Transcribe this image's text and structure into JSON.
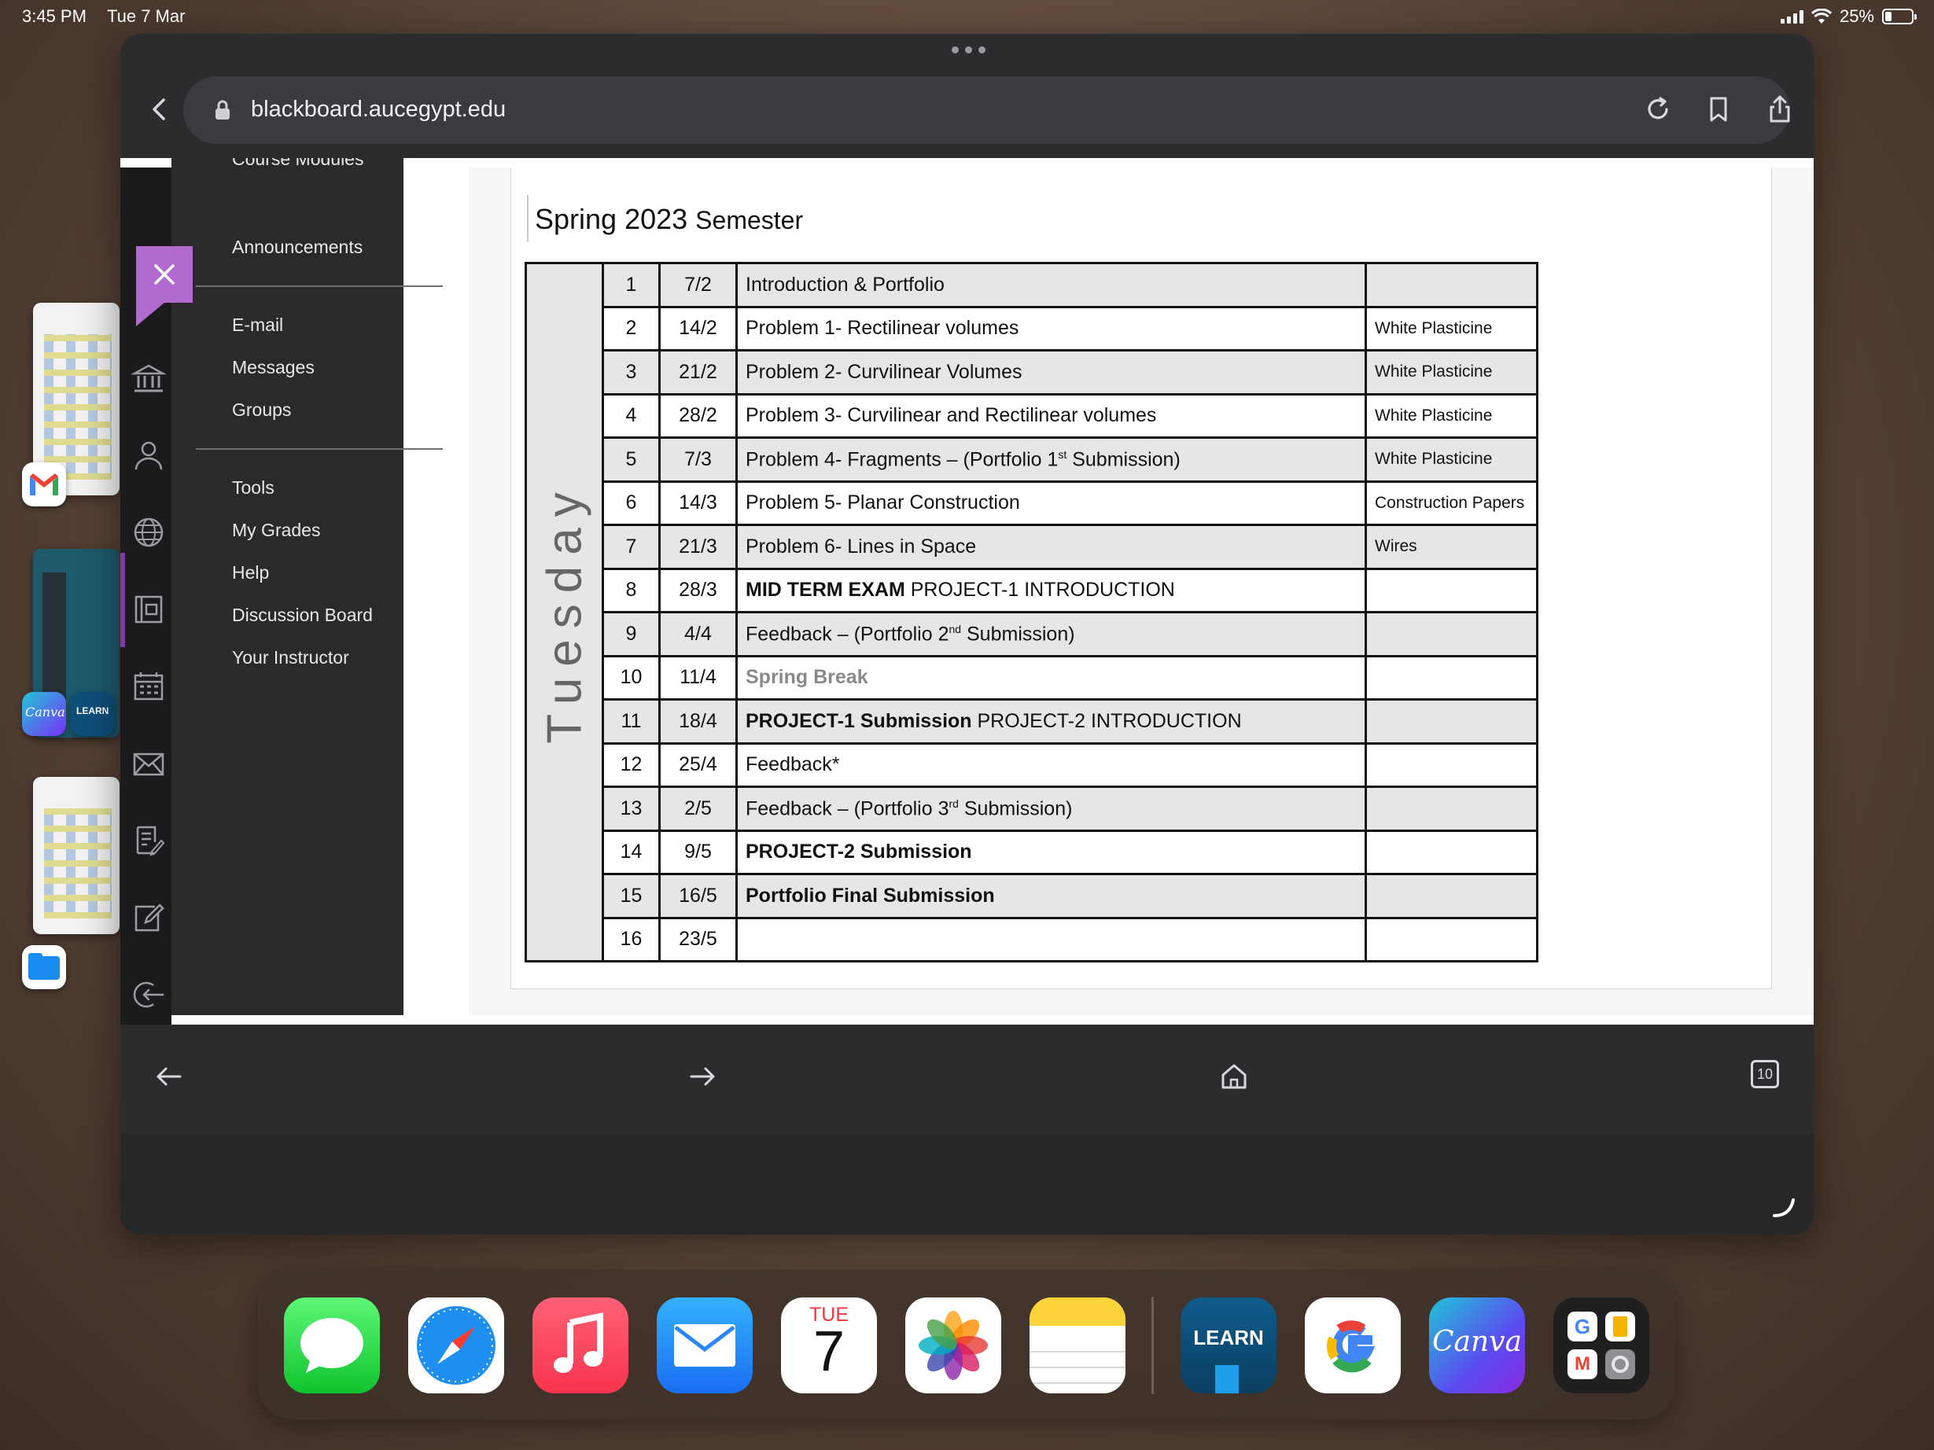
{
  "status_bar": {
    "time": "3:45 PM",
    "date": "Tue 7 Mar",
    "battery": "25%",
    "battery_level": 0.25
  },
  "browser": {
    "url": "blackboard.aucegypt.edu"
  },
  "course_menu": {
    "items": [
      {
        "label": "Course Modules"
      },
      {
        "label": "Announcements"
      },
      {
        "label": "E-mail"
      },
      {
        "label": "Messages"
      },
      {
        "label": "Groups"
      },
      {
        "label": "Tools"
      },
      {
        "label": "My Grades"
      },
      {
        "label": "Help"
      },
      {
        "label": "Discussion Board"
      },
      {
        "label": "Your Instructor"
      }
    ]
  },
  "document": {
    "title_main": "Spring 2023",
    "title_small": "Semester",
    "day": "Tuesday",
    "rows": [
      {
        "num": "1",
        "date": "7/2",
        "parts": [
          {
            "t": "Introduction & Portfolio"
          }
        ],
        "material": ""
      },
      {
        "num": "2",
        "date": "14/2",
        "parts": [
          {
            "t": "Problem 1- Rectilinear volumes"
          }
        ],
        "material": "White Plasticine"
      },
      {
        "num": "3",
        "date": "21/2",
        "parts": [
          {
            "t": "Problem 2- Curvilinear Volumes"
          }
        ],
        "material": "White Plasticine"
      },
      {
        "num": "4",
        "date": "28/2",
        "parts": [
          {
            "t": "Problem 3- Curvilinear and Rectilinear volumes"
          }
        ],
        "material": "White Plasticine"
      },
      {
        "num": "5",
        "date": "7/3",
        "parts": [
          {
            "t": "Problem 4- Fragments – (Portfolio 1"
          },
          {
            "t": "st",
            "sup": true
          },
          {
            "t": " Submission)"
          }
        ],
        "material": "White Plasticine"
      },
      {
        "num": "6",
        "date": "14/3",
        "parts": [
          {
            "t": "Problem 5- Planar Construction"
          }
        ],
        "material": "Construction Papers"
      },
      {
        "num": "7",
        "date": "21/3",
        "parts": [
          {
            "t": "Problem 6- Lines in Space"
          }
        ],
        "material": "Wires"
      },
      {
        "num": "8",
        "date": "28/3",
        "parts": [
          {
            "t": "MID TERM EXAM",
            "b": true
          },
          {
            "t": " PROJECT-1 INTRODUCTION"
          }
        ],
        "material": ""
      },
      {
        "num": "9",
        "date": "4/4",
        "parts": [
          {
            "t": "Feedback – (Portfolio 2"
          },
          {
            "t": "nd",
            "sup": true
          },
          {
            "t": " Submission)"
          }
        ],
        "material": ""
      },
      {
        "num": "10",
        "date": "11/4",
        "parts": [
          {
            "t": "Spring Break",
            "spring": true
          }
        ],
        "material": ""
      },
      {
        "num": "11",
        "date": "18/4",
        "parts": [
          {
            "t": "PROJECT-1 Submission",
            "b": true
          },
          {
            "t": " PROJECT-2 INTRODUCTION"
          }
        ],
        "material": ""
      },
      {
        "num": "12",
        "date": "25/4",
        "parts": [
          {
            "t": "Feedback*"
          }
        ],
        "material": ""
      },
      {
        "num": "13",
        "date": "2/5",
        "parts": [
          {
            "t": "Feedback – (Portfolio 3"
          },
          {
            "t": "rd",
            "sup": true
          },
          {
            "t": " Submission)"
          }
        ],
        "material": ""
      },
      {
        "num": "14",
        "date": "9/5",
        "parts": [
          {
            "t": "PROJECT-2 Submission",
            "b": true
          }
        ],
        "material": ""
      },
      {
        "num": "15",
        "date": "16/5",
        "parts": [
          {
            "t": "Portfolio Final Submission",
            "b": true
          }
        ],
        "material": ""
      },
      {
        "num": "16",
        "date": "23/5",
        "parts": [],
        "material": ""
      }
    ]
  },
  "bottom_toolbar": {
    "tab_count": "10"
  },
  "side_apps": {
    "learn_label": "LEARN",
    "canva_label": "Canva"
  },
  "dock": {
    "calendar_weekday": "TUE",
    "calendar_day": "7",
    "learn_label": "LEARN",
    "canva_label": "Canva"
  },
  "colors": {
    "accent_purple": "#b26ad0",
    "menu_bg": "#2a2a2c",
    "rail_bg": "#1b1b1d"
  }
}
